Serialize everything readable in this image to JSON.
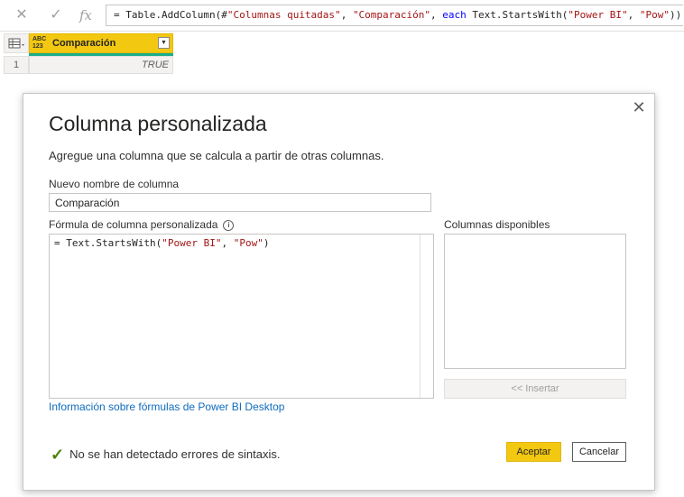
{
  "formula_bar": {
    "cancel_icon": "x-icon",
    "confirm_icon": "check-icon",
    "fx_label": "fx",
    "formula_prefix": "= Table.AddColumn(#",
    "formula_str1": "\"Columnas quitadas\"",
    "formula_sep1": ", ",
    "formula_str2": "\"Comparación\"",
    "formula_sep2": ", ",
    "formula_kw": "each",
    "formula_mid": " Text.StartsWith(",
    "formula_str3": "\"Power BI\"",
    "formula_sep3": ", ",
    "formula_str4": "\"Pow\"",
    "formula_end": "))"
  },
  "grid": {
    "type_badge_top": "ABC",
    "type_badge_bottom": "123",
    "column_name": "Comparación",
    "row_number": "1",
    "cell_value": "TRUE",
    "quality_color": "#1aae8b"
  },
  "dialog": {
    "title": "Columna personalizada",
    "description": "Agregue una columna que se calcula a partir de otras columnas.",
    "name_label": "Nuevo nombre de columna",
    "name_value": "Comparación",
    "formula_label": "Fórmula de columna personalizada",
    "info_glyph": "i",
    "formula_code_prefix": "= Text.StartsWith(",
    "formula_code_str1": "\"Power BI\"",
    "formula_code_sep": ", ",
    "formula_code_str2": "\"Pow\"",
    "formula_code_end": ")",
    "available_label": "Columnas disponibles",
    "insert_label": "<< Insertar",
    "link_text": "Información sobre fórmulas de Power BI Desktop",
    "status_text": "No se han detectado errores de sintaxis.",
    "ok_label": "Aceptar",
    "cancel_label": "Cancelar",
    "accent_color": "#f2c811",
    "link_color": "#0f6cbd"
  }
}
